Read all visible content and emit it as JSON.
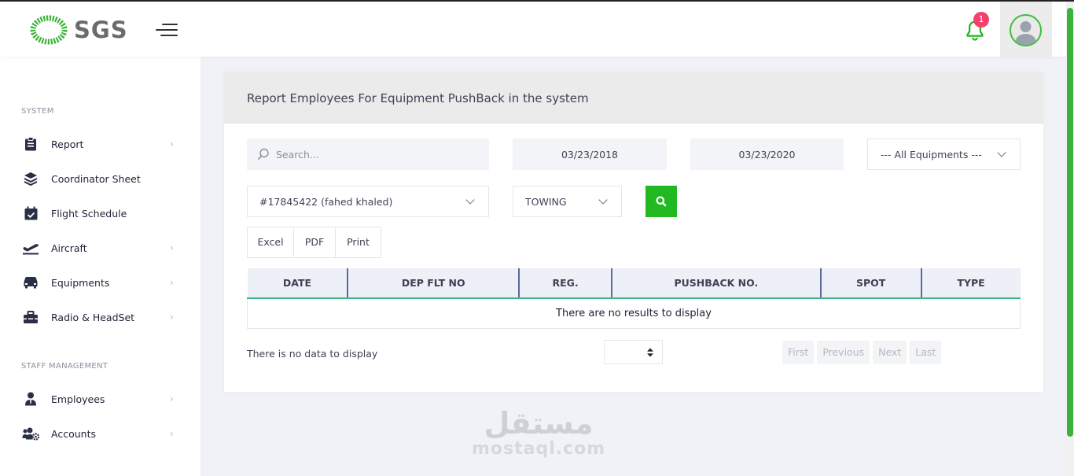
{
  "app": {
    "logo_text": "SGS",
    "brand_color": "#22b822"
  },
  "header": {
    "notification_count": "1"
  },
  "sidebar": {
    "system_title": "SYSTEM",
    "staff_title": "STAFF MANAGEMENT",
    "items": [
      {
        "label": "Report",
        "icon": "clipboard-icon",
        "has_children": true
      },
      {
        "label": "Coordinator Sheet",
        "icon": "layers-icon",
        "has_children": false
      },
      {
        "label": "Flight Schedule",
        "icon": "calendar-check-icon",
        "has_children": false
      },
      {
        "label": "Aircraft",
        "icon": "plane-departure-icon",
        "has_children": true
      },
      {
        "label": "Equipments",
        "icon": "truck-icon",
        "has_children": true
      },
      {
        "label": "Radio & HeadSet",
        "icon": "toolbox-icon",
        "has_children": true
      },
      {
        "label": "Employees",
        "icon": "user-tie-icon",
        "has_children": true
      },
      {
        "label": "Accounts",
        "icon": "users-cog-icon",
        "has_children": true
      }
    ]
  },
  "main": {
    "title": "Report Employees For Equipment PushBack in the system",
    "filters": {
      "search_placeholder": "Search...",
      "date_from": "03/23/2018",
      "date_to": "03/23/2020",
      "equipment": "--- All Equipments ---",
      "employee": "#17845422 (fahed khaled)",
      "operation": "TOWING"
    },
    "export_buttons": [
      "Excel",
      "PDF",
      "Print"
    ],
    "table": {
      "columns": [
        "DATE",
        "DEP FLT NO",
        "REG.",
        "PUSHBACK NO.",
        "SPOT",
        "TYPE"
      ],
      "empty_message": "There are no results to display"
    },
    "no_data_text": "There is no data to display",
    "pager": [
      "First",
      "Previous",
      "Next",
      "Last"
    ]
  },
  "watermark": {
    "arabic": "مستقل",
    "latin": "mostaql.com"
  }
}
